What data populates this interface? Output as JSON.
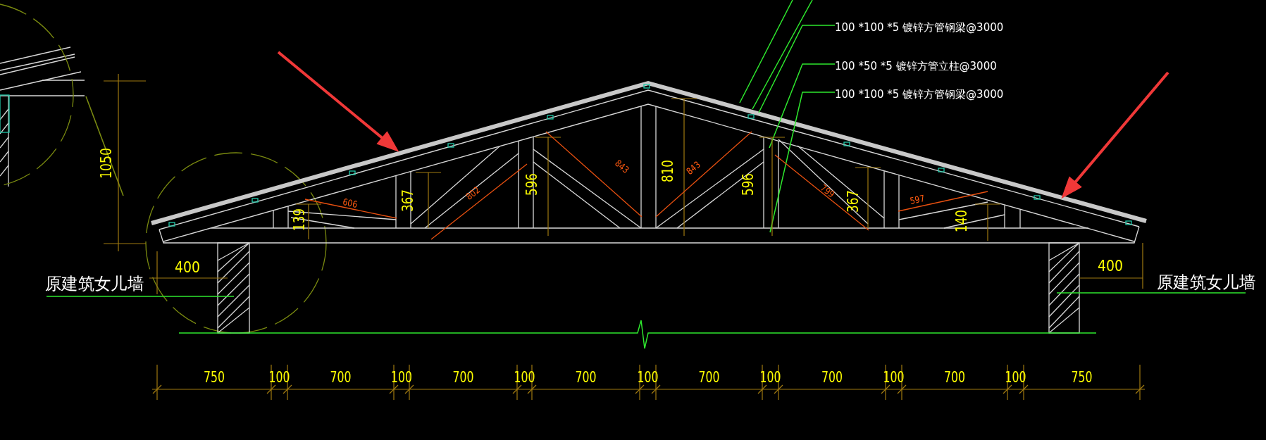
{
  "callouts": [
    {
      "text": "100 *100 *5 镀锌方管钢梁@3000"
    },
    {
      "text": "100 *50 *5 镀锌方管立柱@3000"
    },
    {
      "text": "100 *100 *5 镀锌方管钢梁@3000"
    }
  ],
  "wall_labels": [
    "原建筑女儿墙",
    "原建筑女儿墙"
  ],
  "wall_dims": [
    "400",
    "400"
  ],
  "height_dim": "1050",
  "member_dims": [
    {
      "text": "139",
      "kind": "vertical"
    },
    {
      "text": "606",
      "kind": "aligned"
    },
    {
      "text": "367",
      "kind": "vertical"
    },
    {
      "text": "802",
      "kind": "aligned"
    },
    {
      "text": "596",
      "kind": "vertical"
    },
    {
      "text": "843",
      "kind": "aligned"
    },
    {
      "text": "810",
      "kind": "vertical"
    },
    {
      "text": "843",
      "kind": "aligned"
    },
    {
      "text": "596",
      "kind": "vertical"
    },
    {
      "text": "799",
      "kind": "aligned"
    },
    {
      "text": "367",
      "kind": "vertical"
    },
    {
      "text": "597",
      "kind": "aligned"
    },
    {
      "text": "140",
      "kind": "vertical"
    }
  ],
  "bottom_dims": [
    "750",
    "100",
    "700",
    "100",
    "700",
    "100",
    "700",
    "100",
    "700",
    "100",
    "700",
    "100",
    "700",
    "100",
    "750"
  ]
}
